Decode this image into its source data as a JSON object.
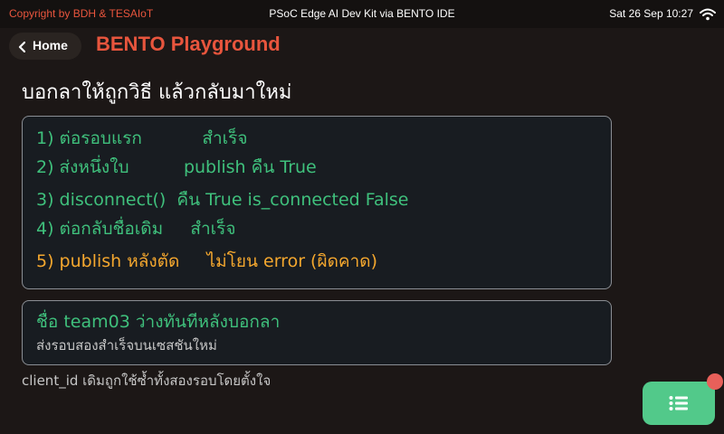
{
  "status_bar": {
    "copyright": "Copyright by BDH & TESAIoT",
    "title": "PSoC Edge AI Dev Kit via BENTO IDE",
    "datetime": "Sat 26 Sep 10:27",
    "wifi_icon": "wifi-icon"
  },
  "header": {
    "home_label": "Home",
    "app_title": "BENTO Playground"
  },
  "page": {
    "heading": "บอกลาให้ถูกวิธี แล้วกลับมาใหม่"
  },
  "steps": [
    {
      "text": "1) ต่อรอบแรก           สำเร็จ",
      "status": "ok"
    },
    {
      "text": "2) ส่งหนึ่งใบ          publish คืน True",
      "status": "ok"
    },
    {
      "text": "3) disconnect()  คืน True is_connected False",
      "status": "ok"
    },
    {
      "text": "4) ต่อกลับชื่อเดิม     สำเร็จ",
      "status": "ok"
    },
    {
      "text": "5) publish หลังตัด     ไม่โยน error (ผิดคาด)",
      "status": "warn"
    }
  ],
  "info": {
    "title": "ชื่อ team03 ว่างทันทีหลังบอกลา",
    "subtitle": "ส่งรอบสองสำเร็จบนเซสชันใหม่"
  },
  "footnote": "client_id เดิมถูกใช้ซ้ำทั้งสองรอบโดยตั้งใจ",
  "fab": {
    "icon": "list-icon",
    "badge": "notification-badge"
  },
  "colors": {
    "accent": "#e8553d",
    "success": "#3fc07c",
    "warning": "#f4a72e",
    "fab": "#52c98a",
    "badge": "#e8605a",
    "background": "#1c1716"
  }
}
